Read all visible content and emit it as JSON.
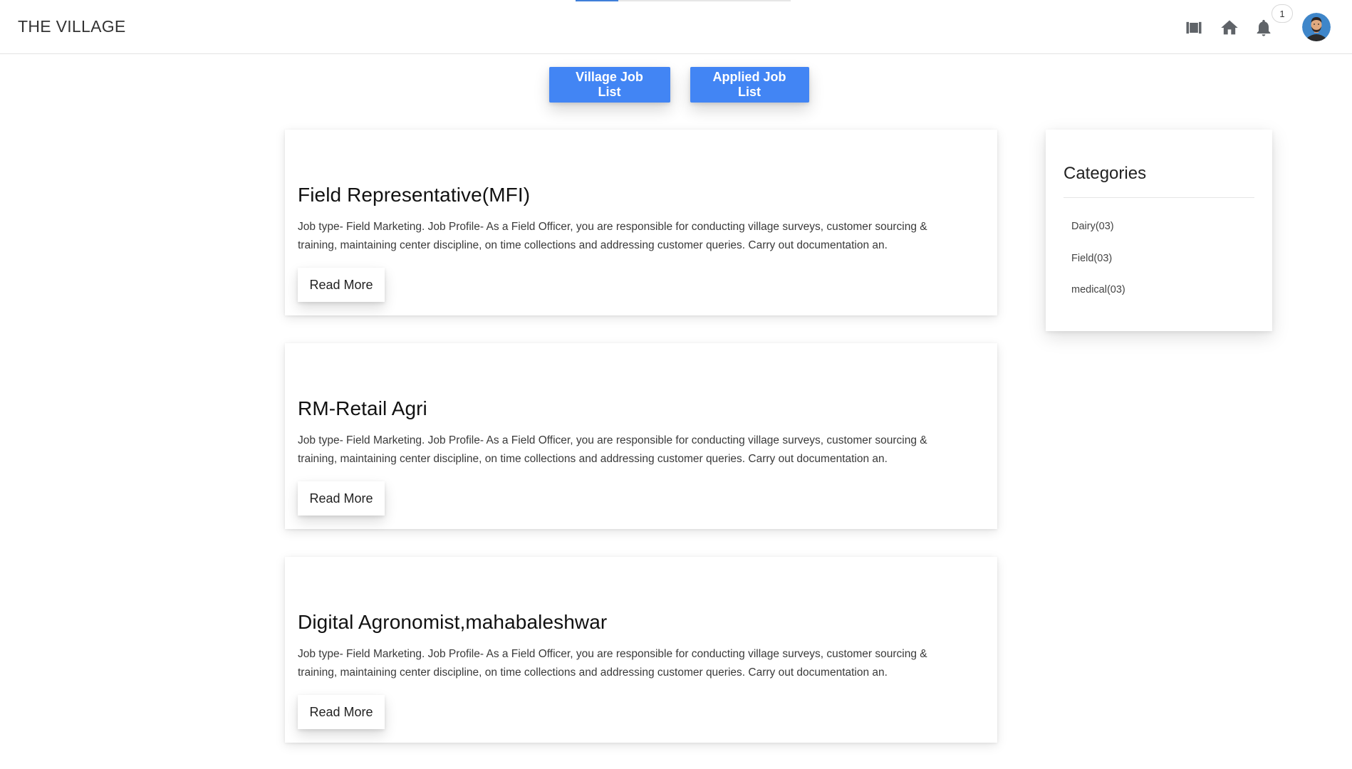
{
  "header": {
    "brand": "THE VILLAGE",
    "notification_count": "1",
    "loading_progress": 0.2,
    "icons": [
      "film-reel-icon",
      "home-icon",
      "bell-icon"
    ]
  },
  "tabs": [
    {
      "label": "Village Job List"
    },
    {
      "label": "Applied Job List"
    }
  ],
  "jobs": [
    {
      "title": "Field Representative(MFI)",
      "description": "Job type- Field Marketing. Job Profile- As a Field Officer, you are responsible for conducting village surveys, customer sourcing & training, maintaining center discipline, on time collections and addressing customer queries. Carry out documentation an.",
      "button": "Read More"
    },
    {
      "title": "RM-Retail Agri",
      "description": "Job type- Field Marketing. Job Profile- As a Field Officer, you are responsible for conducting village surveys, customer sourcing & training, maintaining center discipline, on time collections and addressing customer queries. Carry out documentation an.",
      "button": "Read More"
    },
    {
      "title": "Digital Agronomist,mahabaleshwar",
      "description": "Job type- Field Marketing. Job Profile- As a Field Officer, you are responsible for conducting village surveys, customer sourcing & training, maintaining center discipline, on time collections and addressing customer queries. Carry out documentation an.",
      "button": "Read More"
    }
  ],
  "sidebar": {
    "title": "Categories",
    "items": [
      {
        "label": "Dairy(03)"
      },
      {
        "label": "Field(03)"
      },
      {
        "label": "medical(03)"
      }
    ]
  },
  "colors": {
    "accent": "#4285f4",
    "icon": "#5f6368",
    "text": "#212121"
  }
}
